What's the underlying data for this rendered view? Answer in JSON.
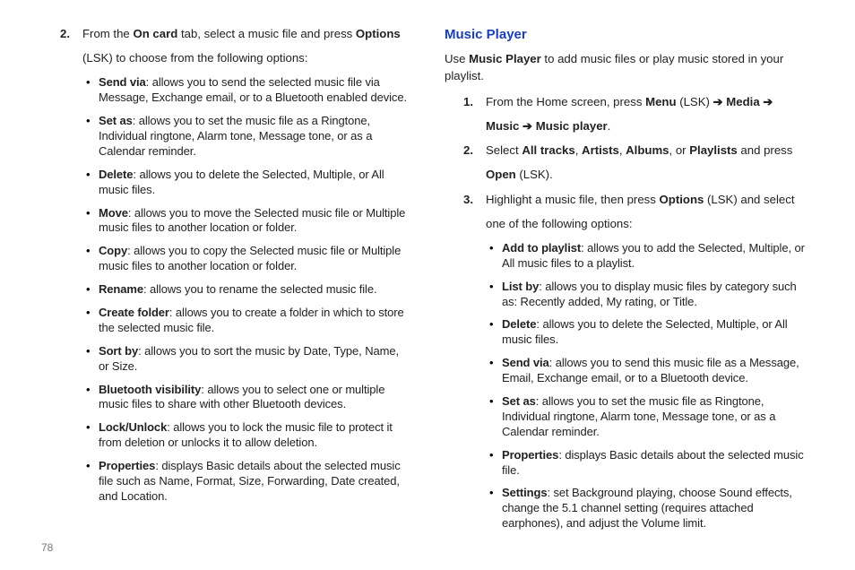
{
  "left": {
    "step2": {
      "num": "2.",
      "t1_pre": "From the ",
      "t1_b1": "On card",
      "t1_mid": " tab, select a music file and press ",
      "t1_b2": "Options",
      "t2": "(LSK) to choose from the following options:"
    },
    "bullets": [
      {
        "b": "Send via",
        "t": ": allows you to send the selected music file via Message, Exchange email, or to a Bluetooth enabled device."
      },
      {
        "b": "Set as",
        "t": ": allows you to set the music file as a Ringtone, Individual ringtone, Alarm tone, Message tone, or as a Calendar reminder."
      },
      {
        "b": "Delete",
        "t": ": allows you to delete the Selected, Multiple, or All music files."
      },
      {
        "b": "Move",
        "t": ": allows you to move the Selected music file or Multiple music files to another location or folder."
      },
      {
        "b": "Copy",
        "t": ": allows you to copy the Selected music file or Multiple music files to another location or folder."
      },
      {
        "b": "Rename",
        "t": ": allows you to rename the selected music file."
      },
      {
        "b": "Create folder",
        "t": ": allows you to create a folder in which to store the selected music file."
      },
      {
        "b": "Sort by",
        "t": ": allows you to sort the music by Date, Type, Name, or Size."
      },
      {
        "b": "Bluetooth visibility",
        "t": ": allows you to select one or multiple music files to share with other Bluetooth devices."
      },
      {
        "b": "Lock/Unlock",
        "t": ": allows you to lock the music file to protect it from deletion or unlocks it to allow deletion."
      },
      {
        "b": "Properties",
        "t": ": displays Basic details about the selected music file such as Name, Format, Size, Forwarding, Date created, and Location."
      }
    ]
  },
  "right": {
    "heading": "Music Player",
    "intro_pre": "Use ",
    "intro_b": "Music Player",
    "intro_post": " to add music files or play music stored in your playlist.",
    "step1": {
      "num": "1.",
      "pre": "From the Home screen, press ",
      "menu": "Menu",
      "lsk": " (LSK) ",
      "arrow": "➔",
      "media": " Media ",
      "music": "Music ",
      "mplayer": " Music player",
      "dot": "."
    },
    "step2": {
      "num": "2.",
      "pre": "Select ",
      "a1": "All tracks",
      "c1": ", ",
      "a2": "Artists",
      "c2": ", ",
      "a3": "Albums",
      "c3": ", or ",
      "a4": "Playlists",
      "mid": " and press ",
      "open": "Open",
      "lsk": " (LSK)."
    },
    "step3": {
      "num": "3.",
      "pre": "Highlight a music file, then press ",
      "opt": "Options",
      "post1": " (LSK) and select",
      "post2": "one of the following options:"
    },
    "bullets": [
      {
        "b": "Add to playlist",
        "t": ": allows you to add the Selected, Multiple, or All music files to a playlist."
      },
      {
        "b": "List by",
        "t": ": allows you to display music files by category such as: Recently added, My rating, or Title."
      },
      {
        "b": "Delete",
        "t": ": allows you to delete the Selected, Multiple, or All music files."
      },
      {
        "b": "Send via",
        "t": ": allows you to send this music file as a Message, Email, Exchange email, or to a Bluetooth device."
      },
      {
        "b": "Set as",
        "t": ": allows you to set the music file as Ringtone, Individual ringtone, Alarm tone, Message tone, or as a Calendar reminder."
      },
      {
        "b": "Properties",
        "t": ": displays Basic details about the selected music file."
      },
      {
        "b": "Settings",
        "t": ": set Background playing, choose Sound effects, change the 5.1 channel setting (requires attached earphones), and adjust the Volume limit."
      }
    ]
  },
  "pagenum": "78"
}
